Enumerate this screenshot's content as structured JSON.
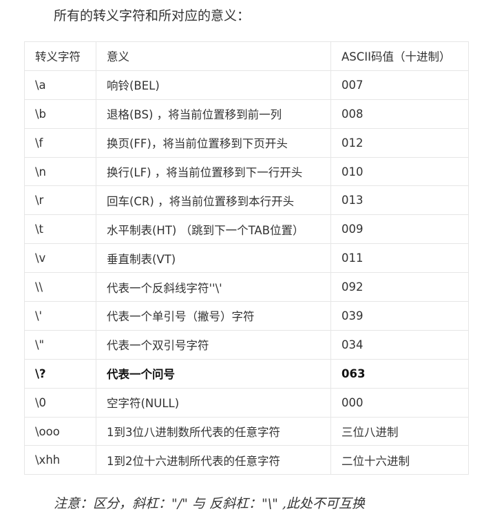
{
  "heading": "所有的转义字符和所对应的意义：",
  "table": {
    "headers": [
      "转义字符",
      "意义",
      "ASCII码值（十进制）"
    ],
    "rows": [
      [
        "\\a",
        "响铃(BEL)",
        "007"
      ],
      [
        "\\b",
        "退格(BS) ，将当前位置移到前一列",
        "008"
      ],
      [
        "\\f",
        "换页(FF)，将当前位置移到下页开头",
        "012"
      ],
      [
        "\\n",
        "换行(LF) ，将当前位置移到下一行开头",
        "010"
      ],
      [
        "\\r",
        "回车(CR) ，将当前位置移到本行开头",
        "013"
      ],
      [
        "\\t",
        "水平制表(HT) （跳到下一个TAB位置）",
        "009"
      ],
      [
        "\\v",
        "垂直制表(VT)",
        "011"
      ],
      [
        "\\\\",
        "代表一个反斜线字符''\\'",
        "092"
      ],
      [
        "\\'",
        "代表一个单引号（撇号）字符",
        "039"
      ],
      [
        "\\\"",
        "代表一个双引号字符",
        "034"
      ],
      [
        "\\?",
        "代表一个问号",
        "063"
      ],
      [
        "\\0",
        "空字符(NULL)",
        "000"
      ],
      [
        "\\ooo",
        "1到3位八进制数所代表的任意字符",
        "三位八进制"
      ],
      [
        "\\xhh",
        "1到2位十六进制所代表的任意字符",
        "二位十六进制"
      ]
    ]
  },
  "note": "注意：区分，斜杠：\"/\" 与 反斜杠：\"\\\" ,此处不可互换"
}
